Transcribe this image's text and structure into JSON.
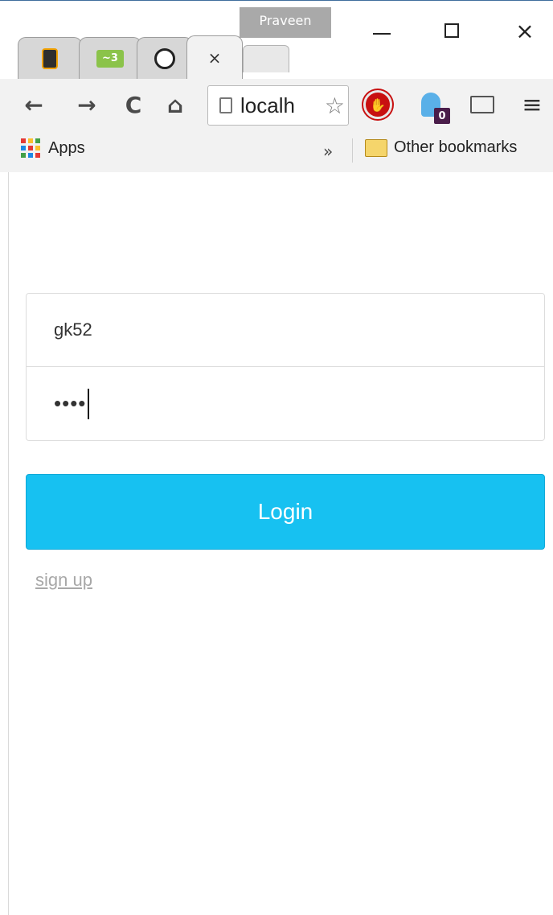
{
  "window": {
    "profile_name": "Praveen",
    "minimize_label": "",
    "close_glyph": "×"
  },
  "tabs": [
    {
      "icon": "lighthouse-favicon-icon",
      "glyph": ""
    },
    {
      "icon": "w3-favicon-icon",
      "glyph": "~3"
    },
    {
      "icon": "github-favicon-icon",
      "glyph": ""
    },
    {
      "icon": "active-tab",
      "close_glyph": "×"
    },
    {
      "icon": "new-tab-button",
      "glyph": ""
    }
  ],
  "toolbar": {
    "back_glyph": "←",
    "forward_glyph": "→",
    "reload_glyph": "C",
    "home_glyph": "⌂",
    "address_text": "localh",
    "star_glyph": "☆",
    "adblock_glyph": "✋",
    "ghostery_count": "0",
    "menu_glyph": "≡"
  },
  "bookmarks": {
    "apps_label": "Apps",
    "more_glyph": "»",
    "other_label": "Other bookmarks"
  },
  "login_form": {
    "username_value": "gk52",
    "password_masked": "••••",
    "login_label": "Login",
    "signup_label": "sign up"
  },
  "colors": {
    "login_button": "#17c1f1",
    "signup_link": "#a8a8a8",
    "adblock_red": "#c81010",
    "ghostery_blue": "#5ab0e8"
  }
}
